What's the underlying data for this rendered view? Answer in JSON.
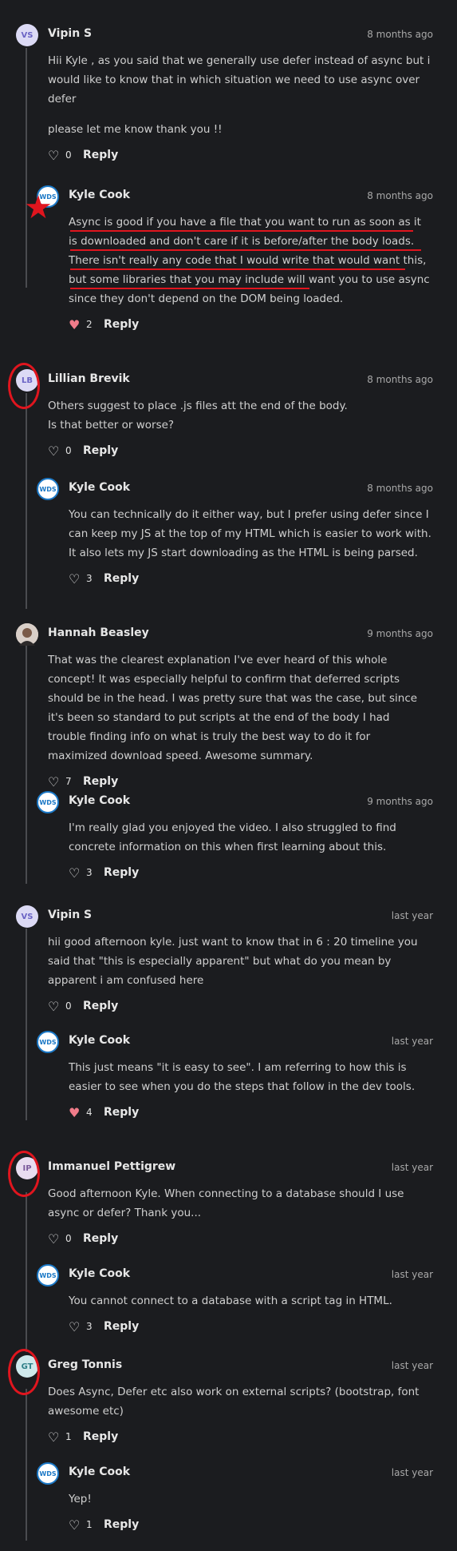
{
  "comments": [
    {
      "author": "Vipin S",
      "avatar": "VS",
      "time": "8 months ago",
      "body": [
        "Hii Kyle , as you said that we generally use defer instead of async but i would like to know that in which situation we need to use async over defer",
        "please let me know thank you !!"
      ],
      "likes": "0",
      "reply": "Reply",
      "reply_comment": {
        "author": "Kyle Cook",
        "avatar": "WDS",
        "time": "8 months ago",
        "body": [
          "Async is good if you have a file that you want to run as soon as it is downloaded and don't care if it is before/after the body loads. There isn't really any code that I would write that would want this, but some libraries that you may include will want you to use async since they don't depend on the DOM being loaded."
        ],
        "likes": "2",
        "reply": "Reply"
      }
    },
    {
      "author": "Lillian Brevik",
      "avatar": "LB",
      "time": "8 months ago",
      "body": [
        "Others suggest to place .js files att the end of the body.",
        "Is that better or worse?"
      ],
      "likes": "0",
      "reply": "Reply",
      "reply_comment": {
        "author": "Kyle Cook",
        "avatar": "WDS",
        "time": "8 months ago",
        "body": [
          "You can technically do it either way, but I prefer using defer since I can keep my JS at the top of my HTML which is easier to work with. It also lets my JS start downloading as the HTML is being parsed."
        ],
        "likes": "3",
        "reply": "Reply"
      }
    },
    {
      "author": "Hannah Beasley",
      "avatar": "",
      "time": "9 months ago",
      "body": [
        "That was the clearest explanation I've ever heard of this whole concept! It was especially helpful to confirm that deferred scripts should be in the head. I was pretty sure that was the case, but since it's been so standard to put scripts at the end of the body I had trouble finding info on what is truly the best way to do it for maximized download speed. Awesome summary."
      ],
      "likes": "7",
      "reply": "Reply",
      "reply_comment": {
        "author": "Kyle Cook",
        "avatar": "WDS",
        "time": "9 months ago",
        "body": [
          "I'm really glad you enjoyed the video. I also struggled to find concrete information on this when first learning about this."
        ],
        "likes": "3",
        "reply": "Reply"
      }
    },
    {
      "author": "Vipin S",
      "avatar": "VS",
      "time": "last year",
      "body": [
        "hii good afternoon kyle. just want to know that in 6 : 20 timeline you said that \"this is especially apparent\" but what do you mean by apparent i am confused here"
      ],
      "likes": "0",
      "reply": "Reply",
      "reply_comment": {
        "author": "Kyle Cook",
        "avatar": "WDS",
        "time": "last year",
        "body": [
          "This just means \"it is easy to see\". I am referring to how this is easier to see when you do the steps that follow in the dev tools."
        ],
        "likes": "4",
        "reply": "Reply"
      }
    },
    {
      "author": "Immanuel Pettigrew",
      "avatar": "IP",
      "time": "last year",
      "body": [
        "Good afternoon Kyle. When connecting to a database should I use async or defer? Thank you..."
      ],
      "likes": "0",
      "reply": "Reply",
      "reply_comment": {
        "author": "Kyle Cook",
        "avatar": "WDS",
        "time": "last year",
        "body": [
          "You cannot connect to a database with a script tag in HTML."
        ],
        "likes": "3",
        "reply": "Reply"
      }
    },
    {
      "author": "Greg Tonnis",
      "avatar": "GT",
      "time": "last year",
      "body": [
        "Does Async, Defer etc also work on external scripts? (bootstrap, font awesome etc)"
      ],
      "likes": "1",
      "reply": "Reply",
      "reply_comment": {
        "author": "Kyle Cook",
        "avatar": "WDS",
        "time": "last year",
        "body": [
          "Yep!"
        ],
        "likes": "1",
        "reply": "Reply"
      }
    }
  ],
  "colors": {
    "background": "#1b1c1f",
    "annotation": "#e0151e",
    "liked_heart": "#f07c8a"
  },
  "icons": {
    "like": "heart-icon",
    "annotation": "star-icon"
  }
}
